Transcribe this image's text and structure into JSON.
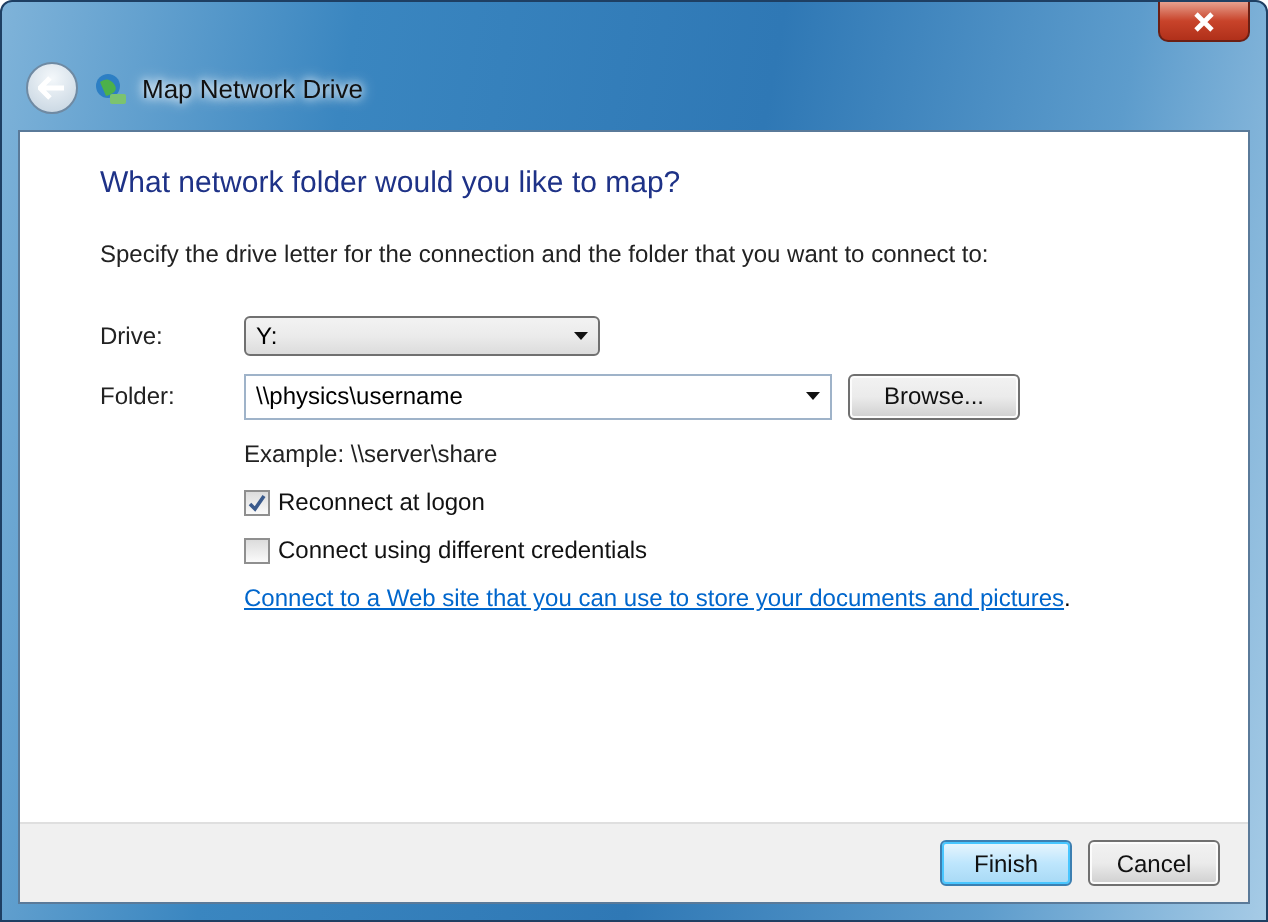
{
  "window": {
    "title": "Map Network Drive"
  },
  "heading": "What network folder would you like to map?",
  "description": "Specify the drive letter for the connection and the folder that you want to connect to:",
  "drive": {
    "label": "Drive:",
    "value": "Y:"
  },
  "folder": {
    "label": "Folder:",
    "value": "\\\\physics\\username",
    "browse": "Browse..."
  },
  "example": "Example: \\\\server\\share",
  "options": [
    {
      "label": "Reconnect at logon",
      "checked": true
    },
    {
      "label": "Connect using different credentials",
      "checked": false
    }
  ],
  "link": {
    "text": "Connect to a Web site that you can use to store your documents and pictures",
    "suffix": "."
  },
  "buttons": [
    {
      "label": "Finish",
      "default": true
    },
    {
      "label": "Cancel",
      "default": false
    }
  ]
}
